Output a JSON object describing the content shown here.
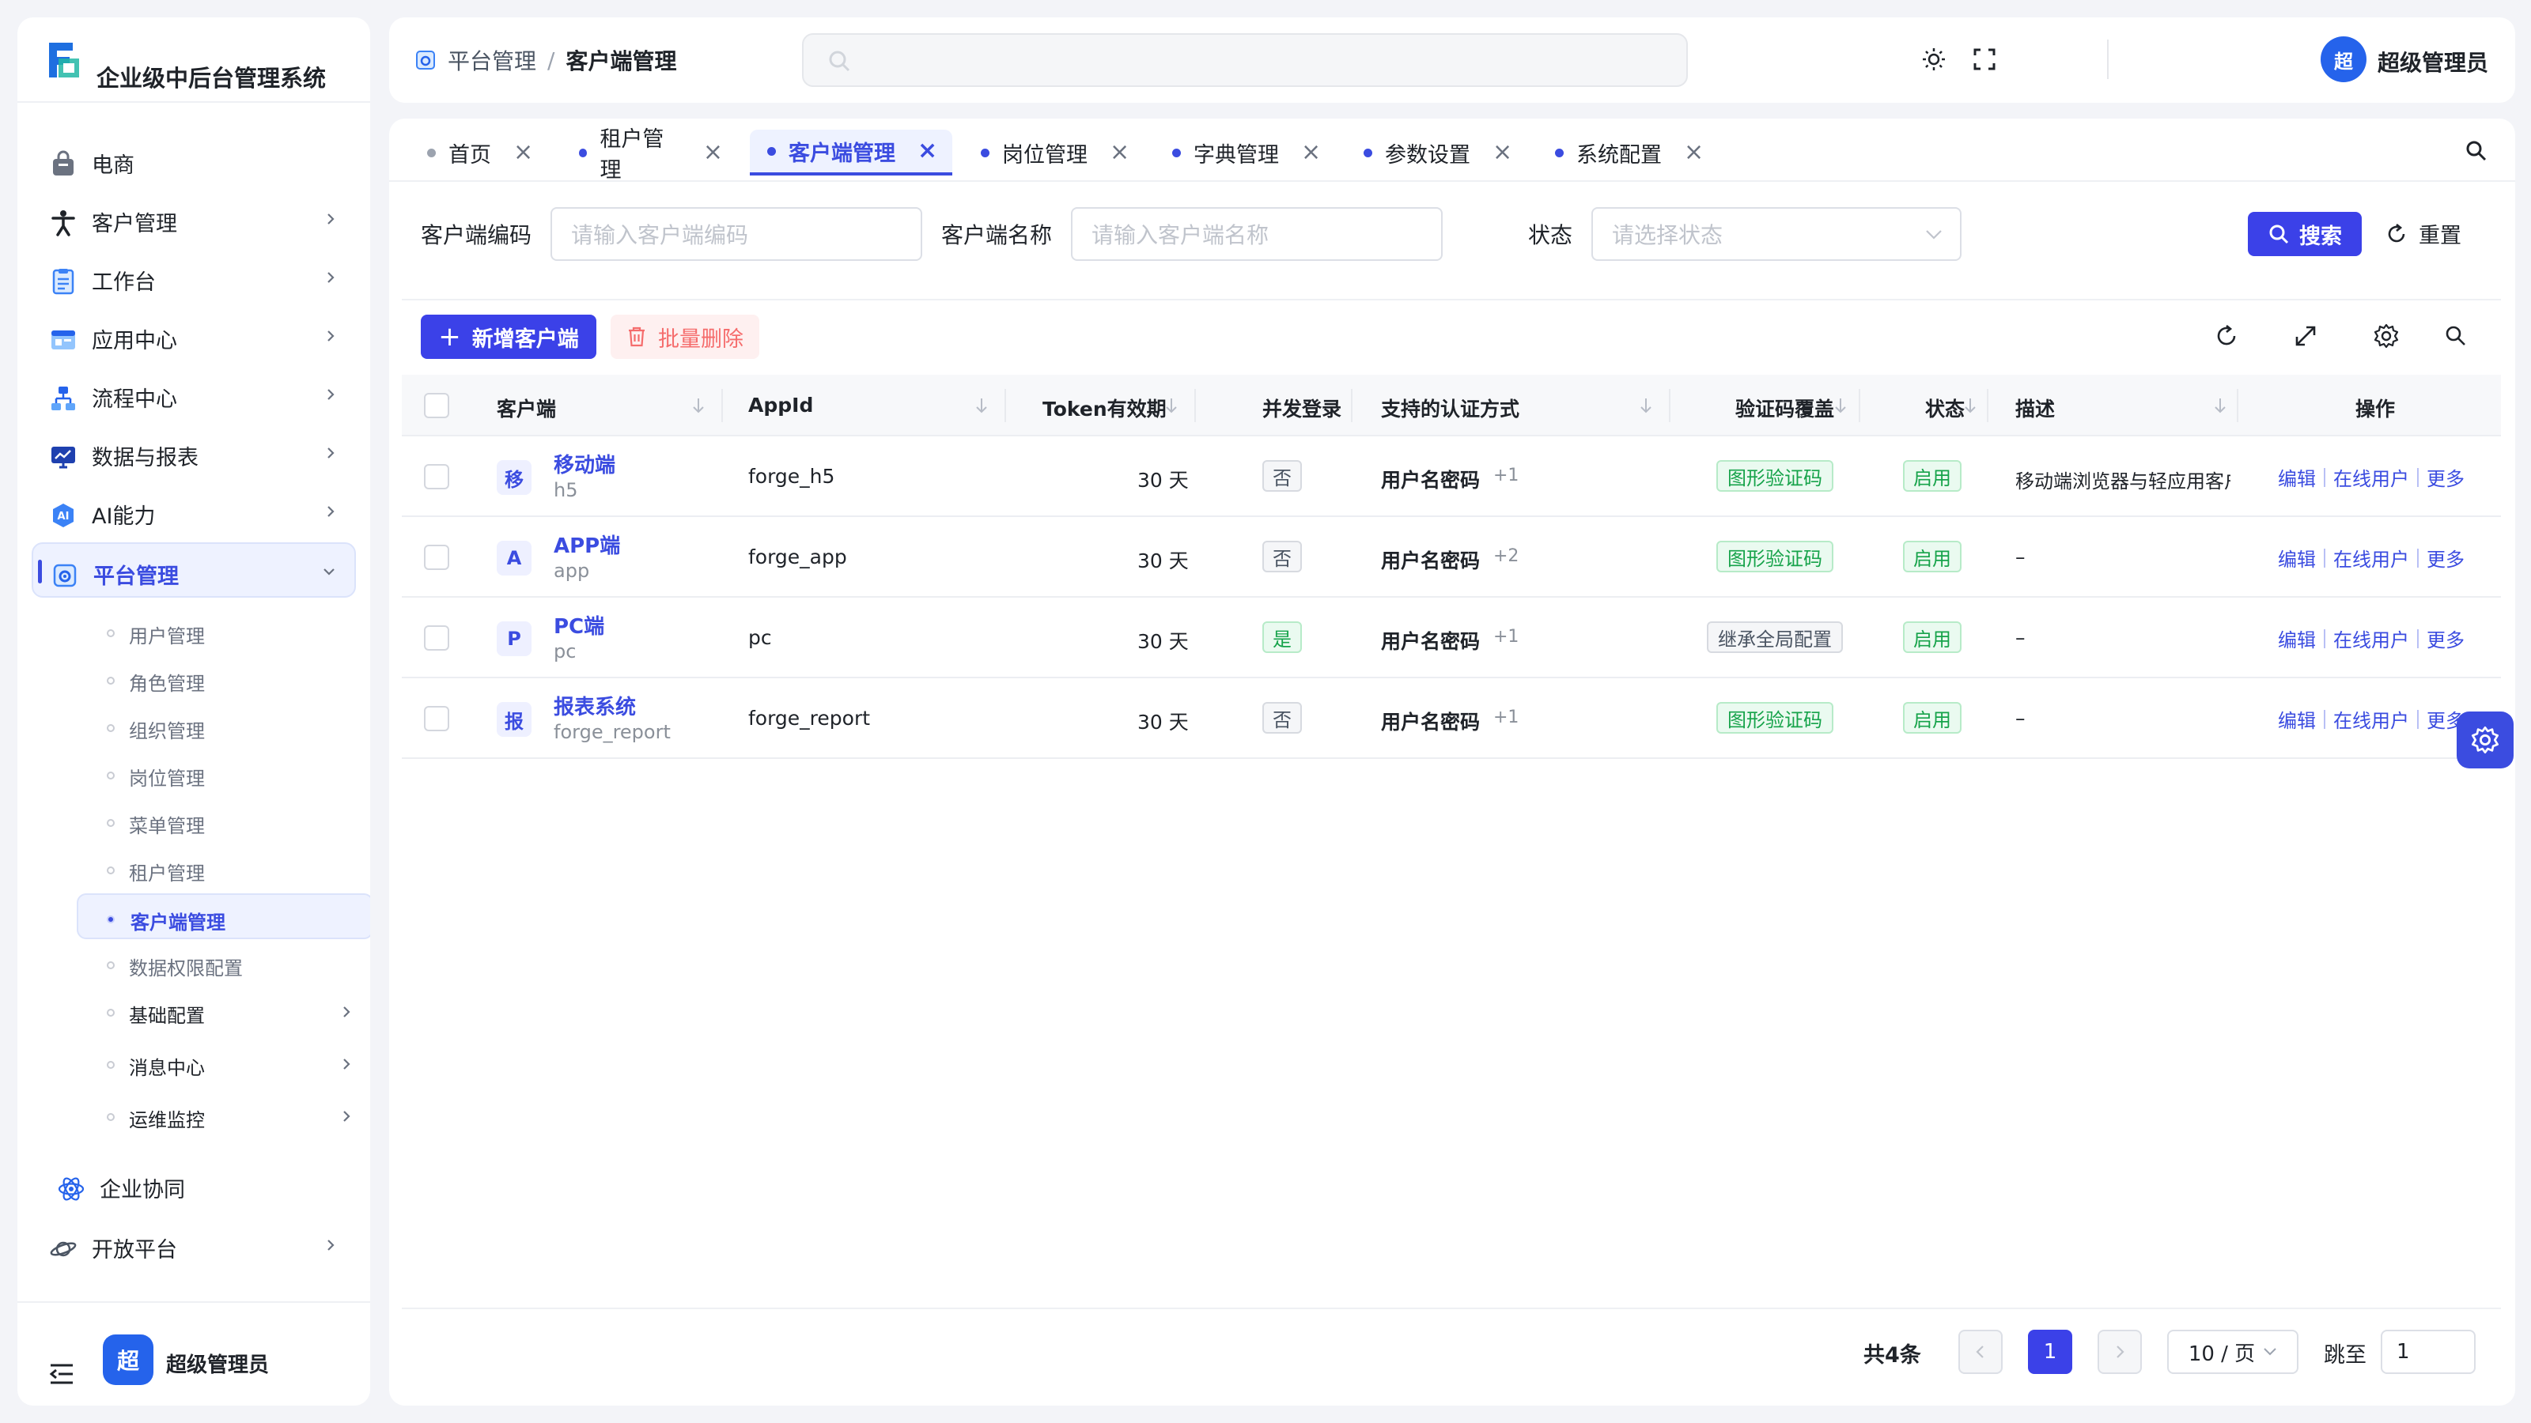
{
  "app": {
    "title": "企业级中后台管理系统"
  },
  "sidebar": {
    "menu": [
      {
        "label": "电商",
        "icon": "shopping-bag-icon",
        "has_arrow": false
      },
      {
        "label": "客户管理",
        "icon": "person-icon",
        "has_arrow": true
      },
      {
        "label": "工作台",
        "icon": "clipboard-icon",
        "has_arrow": true
      },
      {
        "label": "应用中心",
        "icon": "app-window-icon",
        "has_arrow": true
      },
      {
        "label": "流程中心",
        "icon": "flow-icon",
        "has_arrow": true
      },
      {
        "label": "数据与报表",
        "icon": "chart-screen-icon",
        "has_arrow": true
      },
      {
        "label": "AI能力",
        "icon": "ai-icon",
        "has_arrow": true
      },
      {
        "label": "平台管理",
        "icon": "platform-gear-icon",
        "has_arrow": true,
        "expanded": true,
        "active": true
      }
    ],
    "submenu": [
      {
        "label": "用户管理"
      },
      {
        "label": "角色管理"
      },
      {
        "label": "组织管理"
      },
      {
        "label": "岗位管理"
      },
      {
        "label": "菜单管理"
      },
      {
        "label": "租户管理"
      },
      {
        "label": "客户端管理",
        "active": true
      },
      {
        "label": "数据权限配置"
      },
      {
        "label": "基础配置",
        "group": true
      },
      {
        "label": "消息中心",
        "group": true
      },
      {
        "label": "运维监控",
        "group": true
      }
    ],
    "menu_after": [
      {
        "label": "企业协同",
        "icon": "atom-icon",
        "has_arrow": false
      },
      {
        "label": "开放平台",
        "icon": "planet-icon",
        "has_arrow": true
      }
    ],
    "user": {
      "avatar_text": "超",
      "name": "超级管理员"
    }
  },
  "header": {
    "breadcrumb": [
      "平台管理",
      "客户端管理"
    ],
    "search_placeholder": "",
    "user": {
      "avatar_text": "超",
      "name": "超级管理员"
    }
  },
  "tabs": [
    {
      "label": "首页",
      "active": false
    },
    {
      "label": "租户管理",
      "active": false
    },
    {
      "label": "客户端管理",
      "active": true
    },
    {
      "label": "岗位管理",
      "active": false
    },
    {
      "label": "字典管理",
      "active": false
    },
    {
      "label": "参数设置",
      "active": false
    },
    {
      "label": "系统配置",
      "active": false
    }
  ],
  "filters": {
    "code_label": "客户端编码",
    "code_placeholder": "请输入客户端编码",
    "name_label": "客户端名称",
    "name_placeholder": "请输入客户端名称",
    "status_label": "状态",
    "status_placeholder": "请选择状态",
    "search_label": "搜索",
    "reset_label": "重置"
  },
  "toolbar": {
    "add_label": "新增客户端",
    "batch_delete_label": "批量删除"
  },
  "table": {
    "columns": [
      "客户端",
      "AppId",
      "Token有效期",
      "并发登录",
      "支持的认证方式",
      "验证码覆盖",
      "状态",
      "描述",
      "操作"
    ],
    "rows": [
      {
        "badge": "移",
        "name": "移动端",
        "code": "h5",
        "appid": "forge_h5",
        "token": "30 天",
        "concurrent": "否",
        "auth": "用户名密码",
        "auth_extra": "+1",
        "captcha": "图形验证码",
        "status": "启用",
        "desc": "移动端浏览器与轻应用客户端"
      },
      {
        "badge": "A",
        "name": "APP端",
        "code": "app",
        "appid": "forge_app",
        "token": "30 天",
        "concurrent": "否",
        "auth": "用户名密码",
        "auth_extra": "+2",
        "captcha": "图形验证码",
        "status": "启用",
        "desc": "–"
      },
      {
        "badge": "P",
        "name": "PC端",
        "code": "pc",
        "appid": "pc",
        "token": "30 天",
        "concurrent": "是",
        "auth": "用户名密码",
        "auth_extra": "+1",
        "captcha": "继承全局配置",
        "status": "启用",
        "desc": "–"
      },
      {
        "badge": "报",
        "name": "报表系统",
        "code": "forge_report",
        "appid": "forge_report",
        "token": "30 天",
        "concurrent": "否",
        "auth": "用户名密码",
        "auth_extra": "+1",
        "captcha": "图形验证码",
        "status": "启用",
        "desc": "–"
      }
    ],
    "ops": [
      "编辑",
      "在线用户",
      "更多"
    ]
  },
  "pagination": {
    "total_label": "共4条",
    "current_page": "1",
    "page_size": "10 / 页",
    "jump_label": "跳至",
    "jump_value": "1"
  },
  "colors": {
    "primary": "#3b41e8",
    "accent": "#3b4ce0",
    "success": "#16a34a",
    "danger": "#f56c6c"
  }
}
